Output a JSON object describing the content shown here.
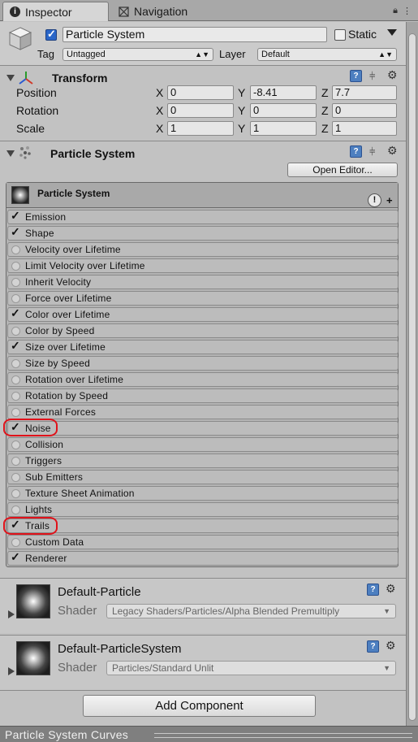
{
  "tabs": [
    {
      "label": "Inspector",
      "icon": "info-icon",
      "active": true
    },
    {
      "label": "Navigation",
      "icon": "navigation-icon",
      "active": false
    }
  ],
  "object": {
    "name": "Particle System",
    "active": true,
    "static_label": "Static",
    "static_checked": false,
    "tag_label": "Tag",
    "tag_value": "Untagged",
    "layer_label": "Layer",
    "layer_value": "Default"
  },
  "transform": {
    "title": "Transform",
    "rows": [
      {
        "label": "Position",
        "x": "0",
        "y": "-8.41",
        "z": "7.7"
      },
      {
        "label": "Rotation",
        "x": "0",
        "y": "0",
        "z": "0"
      },
      {
        "label": "Scale",
        "x": "1",
        "y": "1",
        "z": "1"
      }
    ],
    "axes": [
      "X",
      "Y",
      "Z"
    ]
  },
  "particle_component": {
    "title": "Particle System",
    "open_editor_label": "Open Editor...",
    "panel_title": "Particle System",
    "modules": [
      {
        "label": "Emission",
        "enabled": true
      },
      {
        "label": "Shape",
        "enabled": true
      },
      {
        "label": "Velocity over Lifetime",
        "enabled": false
      },
      {
        "label": "Limit Velocity over Lifetime",
        "enabled": false
      },
      {
        "label": "Inherit Velocity",
        "enabled": false
      },
      {
        "label": "Force over Lifetime",
        "enabled": false
      },
      {
        "label": "Color over Lifetime",
        "enabled": true
      },
      {
        "label": "Color by Speed",
        "enabled": false
      },
      {
        "label": "Size over Lifetime",
        "enabled": true
      },
      {
        "label": "Size by Speed",
        "enabled": false
      },
      {
        "label": "Rotation over Lifetime",
        "enabled": false
      },
      {
        "label": "Rotation by Speed",
        "enabled": false
      },
      {
        "label": "External Forces",
        "enabled": false
      },
      {
        "label": "Noise",
        "enabled": true
      },
      {
        "label": "Collision",
        "enabled": false
      },
      {
        "label": "Triggers",
        "enabled": false
      },
      {
        "label": "Sub Emitters",
        "enabled": false
      },
      {
        "label": "Texture Sheet Animation",
        "enabled": false
      },
      {
        "label": "Lights",
        "enabled": false
      },
      {
        "label": "Trails",
        "enabled": true
      },
      {
        "label": "Custom Data",
        "enabled": false
      },
      {
        "label": "Renderer",
        "enabled": true
      }
    ]
  },
  "materials": [
    {
      "name": "Default-Particle",
      "shader_label": "Shader",
      "shader": "Legacy Shaders/Particles/Alpha Blended Premultiply"
    },
    {
      "name": "Default-ParticleSystem",
      "shader_label": "Shader",
      "shader": "Particles/Standard Unlit"
    }
  ],
  "add_component_label": "Add Component",
  "bottom_panel": {
    "title": "Particle System Curves"
  },
  "icons": {
    "help": "book-help-icon",
    "presets": "sliders-icon",
    "settings": "gear-icon",
    "warning": "info-warning-icon",
    "add": "plus-icon"
  },
  "annotation_color": "#e0121a"
}
